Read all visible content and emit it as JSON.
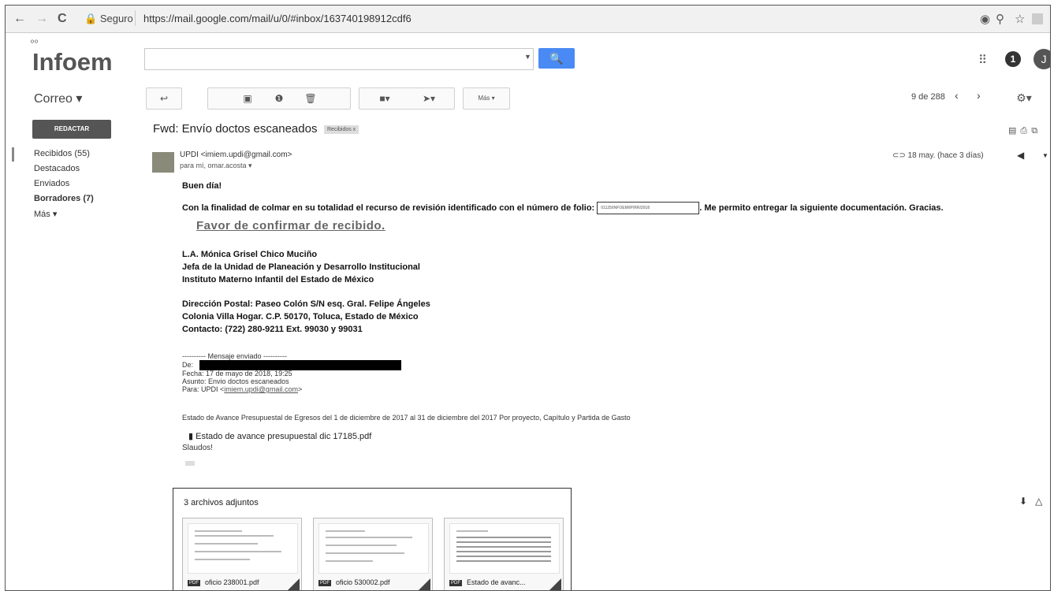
{
  "browser": {
    "back": "←",
    "forward": "→",
    "reload": "C",
    "secure_label": "Seguro",
    "url": "https://mail.google.com/mail/u/0/#inbox/163740198912cdf6",
    "icons": [
      "eye-icon",
      "search-icon",
      "star-icon",
      "extension-icon"
    ]
  },
  "header": {
    "logo_dots": "ºº",
    "logo_text": "Infoem",
    "search_button": "🔍",
    "search_caret": "▼",
    "notif_count": "1",
    "avatar_letter": "J"
  },
  "nav": {
    "gmail_label": "Correo ▾",
    "compose_label": "REDACTAR",
    "items": [
      {
        "label": "Recibidos (55)",
        "bold": false
      },
      {
        "label": "Destacados",
        "bold": false
      },
      {
        "label": "Enviados",
        "bold": false
      },
      {
        "label": "Borradores (7)",
        "bold": true
      },
      {
        "label": "Más ▾",
        "bold": false
      }
    ]
  },
  "toolbar": {
    "back": "↩",
    "archive": "▣",
    "spam": "❶",
    "delete": "🗑",
    "move": "■▾",
    "labels": "➤▾",
    "more": "Más ▾",
    "count": "9 de 288",
    "prev": "‹",
    "next": "›",
    "settings": "⚙▾"
  },
  "message": {
    "subject": "Fwd: Envío doctos escaneados",
    "tag": "Recibidos x",
    "sender": "UPDI <imiem.updi@gmail.com>",
    "recipients": "para mí, omar.acosta ▾",
    "date": "18 may. (hace 3 días)",
    "greeting": "Buen día!",
    "paragraph_before": "Con la finalidad de colmar en su totalidad el recurso de revisión identificado con el número de folio:",
    "folio": "01125/INFOEM/IP/RR/2018",
    "paragraph_after": ". Me permito entregar la siguiente documentación. Gracias.",
    "confirm": "Favor de confirmar de recibido.",
    "signature": [
      "L.A. Mónica Grisel Chico Muciño",
      "Jefa de la Unidad de Planeación y Desarrollo Institucional",
      "Instituto Materno Infantil del Estado de México"
    ],
    "address": [
      "Dirección Postal: Paseo Colón S/N esq. Gral. Felipe Ángeles",
      "Colonia Villa Hogar. C.P. 50170, Toluca, Estado de México",
      "Contacto: (722) 280-9211 Ext. 99030 y 99031"
    ],
    "forwarded_header": "---------- Mensaje enviado ----------",
    "fwd_from_label": "De:",
    "fwd_date": "Fecha: 17 de mayo de 2018, 19:25",
    "fwd_subject": "Asunto: Envio doctos escaneados",
    "fwd_to_prefix": "Para: UPDI <",
    "fwd_to_email": "imiem.updi@gmail.com",
    "fwd_to_suffix": ">",
    "fwd_body": "Estado de Avance Presupuestal de Egresos del 1 de diciembre de 2017 al 31 de diciembre del 2017 Por proyecto, Capítulo y Partida de Gasto",
    "inline_attachment": "Estado de avance presupuestal dic 17185.pdf",
    "closing": "Slaudos!"
  },
  "attachments": {
    "title": "3 archivos adjuntos",
    "badge": "PDF",
    "items": [
      {
        "name": "oficio 238001.pdf"
      },
      {
        "name": "oficio 530002.pdf"
      },
      {
        "name": "Estado de avanc..."
      }
    ]
  }
}
